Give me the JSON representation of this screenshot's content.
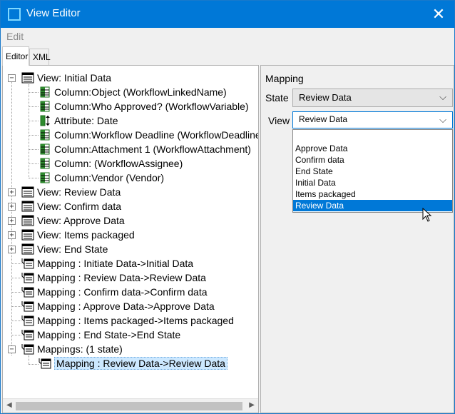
{
  "window": {
    "title": "View Editor"
  },
  "menu": {
    "edit": "Edit"
  },
  "tabs": [
    {
      "label": "Editor"
    },
    {
      "label": "XML"
    }
  ],
  "tree": {
    "root": {
      "view_initial": "View: Initial Data",
      "columns": [
        "Column:Object (WorkflowLinkedName)",
        "Column:Who Approved? (WorkflowVariable)",
        "Attribute: Date",
        "Column:Workflow Deadline (WorkflowDeadline)",
        "Column:Attachment 1 (WorkflowAttachment)",
        "Column: (WorkflowAssignee)",
        "Column:Vendor (Vendor)"
      ],
      "views": [
        "View: Review Data",
        "View: Confirm data",
        "View: Approve Data",
        "View: Items packaged",
        "View: End State"
      ],
      "mappings": [
        "Mapping : Initiate Data->Initial Data",
        "Mapping : Review Data->Review Data",
        "Mapping : Confirm data->Confirm data",
        "Mapping : Approve Data->Approve Data",
        "Mapping : Items packaged->Items packaged",
        "Mapping : End State->End State"
      ],
      "mappings_group": "Mappings: (1 state)",
      "mappings_child": "Mapping : Review Data->Review Data"
    }
  },
  "mapping_panel": {
    "heading": "Mapping",
    "state_label": "State",
    "state_value": "Review Data",
    "view_label": "View",
    "view_value": "Review Data",
    "view_options": [
      "Approve Data",
      "Confirm data",
      "End State",
      "Initial Data",
      "Items packaged",
      "Review Data"
    ],
    "selected_option_index": 5
  },
  "colors": {
    "titlebar": "#0078d7",
    "selection": "#cce8ff",
    "highlight": "#0078d7"
  },
  "icons": {
    "view": "view-list-icon",
    "column": "column-icon",
    "attribute": "attribute-icon",
    "mapping": "mapping-icon"
  }
}
